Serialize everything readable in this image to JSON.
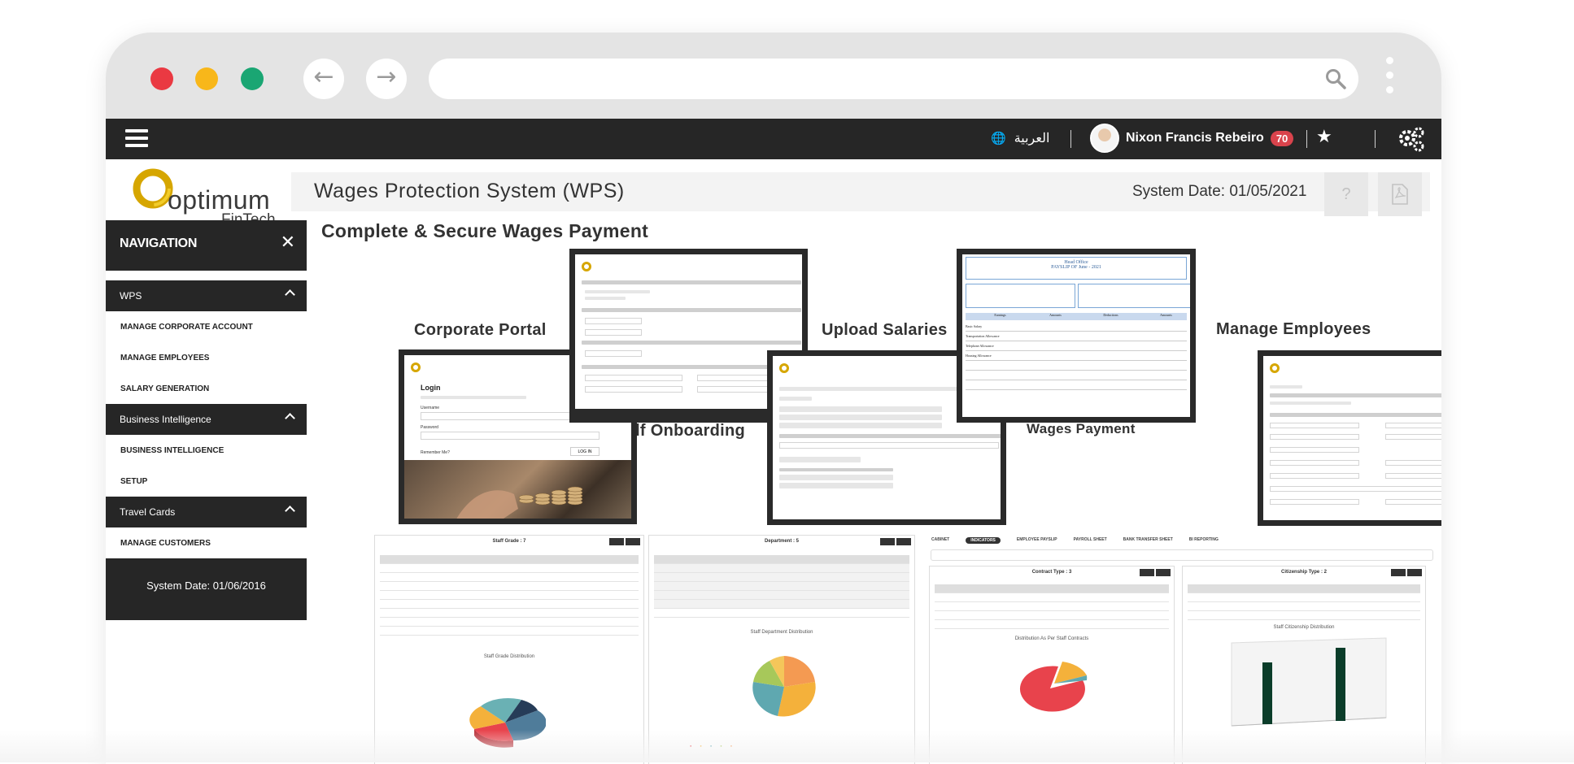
{
  "browser": {
    "url": "",
    "back_icon": "arrow-left-icon",
    "forward_icon": "arrow-right-icon",
    "search_icon": "search-icon"
  },
  "topbar": {
    "language": "العربية",
    "user_name": "Nixon Francis Rebeiro",
    "notification_count": "70"
  },
  "logo": {
    "word": "optimum",
    "sub": "FinTech"
  },
  "header": {
    "title": "Wages Protection System (WPS)",
    "system_date": "System Date: 01/05/2021"
  },
  "sidebar": {
    "heading": "NAVIGATION",
    "sections": [
      {
        "label": "WPS",
        "items": [
          "MANAGE CORPORATE ACCOUNT",
          "MANAGE EMPLOYEES",
          "SALARY GENERATION"
        ]
      },
      {
        "label": "Business Intelligence",
        "items": [
          "BUSINESS INTELLIGENCE",
          "SETUP"
        ]
      },
      {
        "label": "Travel Cards",
        "items": [
          "MANAGE CUSTOMERS"
        ]
      }
    ],
    "footer": "System Date: 01/06/2016"
  },
  "main": {
    "headline": "Complete & Secure Wages Payment",
    "features": [
      "Corporate Portal",
      "Self Onboarding",
      "Upload Salaries",
      "Wages Payment",
      "Manage Employees"
    ],
    "login_mock": {
      "title": "Login",
      "username": "Username",
      "password": "Password",
      "remember": "Remember Me?",
      "button": "LOG IN"
    },
    "payslip_mock": {
      "office": "Head Office",
      "title": "PAYSLIP OF June - 2021",
      "cols": [
        "Earnings",
        "Amounts",
        "Deductions",
        "Amounts"
      ],
      "rows": [
        "Basic Salary",
        "Transportation Allowance",
        "Telephone Allowance",
        "Housing Allowance"
      ]
    }
  },
  "panels": {
    "staff_grade": {
      "title": "Staff Grade : 7",
      "chart_title": "Staff Grade Distribution"
    },
    "department": {
      "title": "Department : 5",
      "chart_title": "Staff Department Distribution"
    },
    "tabs": [
      "CABINET",
      "INDICATORS",
      "EMPLOYEE PAYSLIP",
      "PAYROLL SHEET",
      "BANK TRANSFER SHEET",
      "BI REPORTING"
    ],
    "contract_type": {
      "title": "Contract Type : 3",
      "chart_title": "Distribution As Per Staff Contracts"
    },
    "citizenship_type": {
      "title": "Citizenship Type : 2",
      "chart_title": "Staff Citizenship Distribution"
    }
  },
  "colors": {
    "dark": "#262626",
    "badge": "#d9434c",
    "logo_gold": "#d6a600",
    "dot_red": "#ea3942",
    "dot_yellow": "#f8b71a",
    "dot_green": "#1aa673"
  }
}
